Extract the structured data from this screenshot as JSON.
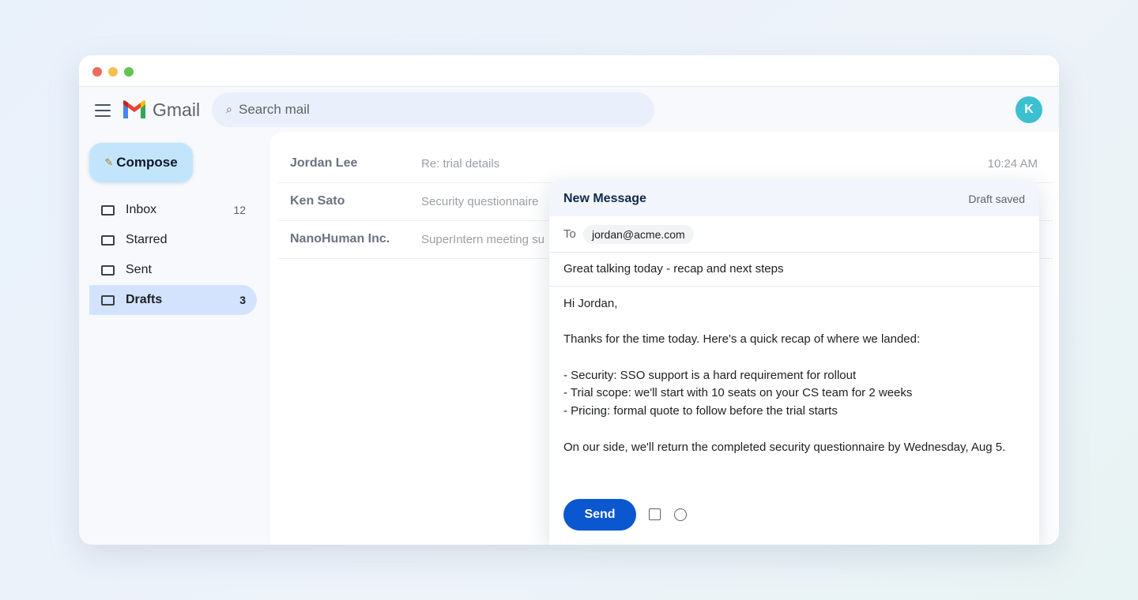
{
  "app": {
    "brand": "Gmail",
    "avatar_initial": "K",
    "accent": "#0b57d0"
  },
  "search": {
    "placeholder": "Search mail"
  },
  "sidebar": {
    "compose_label": "Compose",
    "items": [
      {
        "label": "Inbox",
        "count": "12"
      },
      {
        "label": "Starred",
        "count": ""
      },
      {
        "label": "Sent",
        "count": ""
      },
      {
        "label": "Drafts",
        "count": "3"
      }
    ],
    "active": "Drafts"
  },
  "mail_list": [
    {
      "sender": "Jordan Lee",
      "subject": "Re: trial details",
      "time": "10:24 AM"
    },
    {
      "sender": "Ken Sato",
      "subject": "Security questionnaire",
      "time": ""
    },
    {
      "sender": "NanoHuman Inc.",
      "subject": "SuperIntern meeting su",
      "time": ""
    }
  ],
  "compose": {
    "title": "New Message",
    "status": "Draft saved",
    "to_label": "To",
    "to": "jordan@acme.com",
    "subject": "Great talking today - recap and next steps",
    "body": {
      "greeting": "Hi Jordan,",
      "intro": "Thanks for the time today. Here's a quick recap of where we landed:",
      "bullets": [
        "- Security: SSO support is a hard requirement for rollout",
        "- Trial scope: we'll start with 10 seats on your CS team for 2 weeks",
        "- Pricing: formal quote to follow before the trial starts"
      ],
      "closing": "On our side, we'll return the completed security questionnaire by Wednesday, Aug 5."
    },
    "send_label": "Send"
  }
}
